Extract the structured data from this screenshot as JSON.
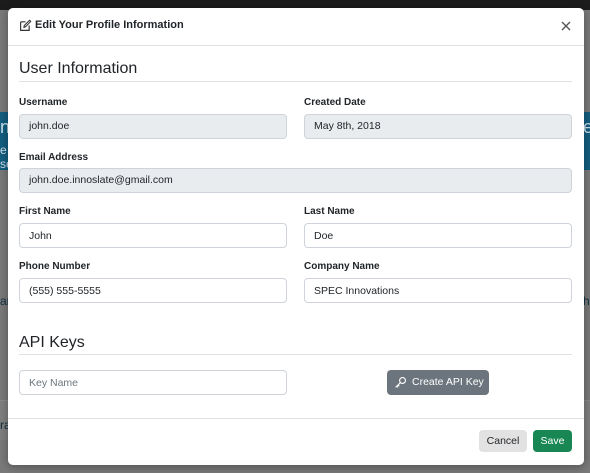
{
  "background": {
    "fragments": [
      "n",
      "e v",
      "se",
      "an",
      "hi",
      "ra",
      "e"
    ]
  },
  "modal": {
    "title": "Edit Your Profile Information",
    "icons": {
      "title": "edit-icon",
      "close": "close-icon",
      "api_key": "key-icon"
    }
  },
  "user_info": {
    "heading": "User Information",
    "username": {
      "label": "Username",
      "value": "john.doe"
    },
    "created_date": {
      "label": "Created Date",
      "value": "May 8th, 2018"
    },
    "email": {
      "label": "Email Address",
      "value": "john.doe.innoslate@gmail.com"
    },
    "first_name": {
      "label": "First Name",
      "value": "John"
    },
    "last_name": {
      "label": "Last Name",
      "value": "Doe"
    },
    "phone": {
      "label": "Phone Number",
      "value": "(555) 555-5555"
    },
    "company": {
      "label": "Company Name",
      "value": "SPEC Innovations"
    }
  },
  "api_keys": {
    "heading": "API Keys",
    "key_name_placeholder": "Key Name",
    "create_label": "Create API Key"
  },
  "footer": {
    "cancel_label": "Cancel",
    "save_label": "Save"
  },
  "colors": {
    "primary_save": "#198754",
    "secondary": "#6c757d",
    "readonly_bg": "#e9ecef"
  }
}
